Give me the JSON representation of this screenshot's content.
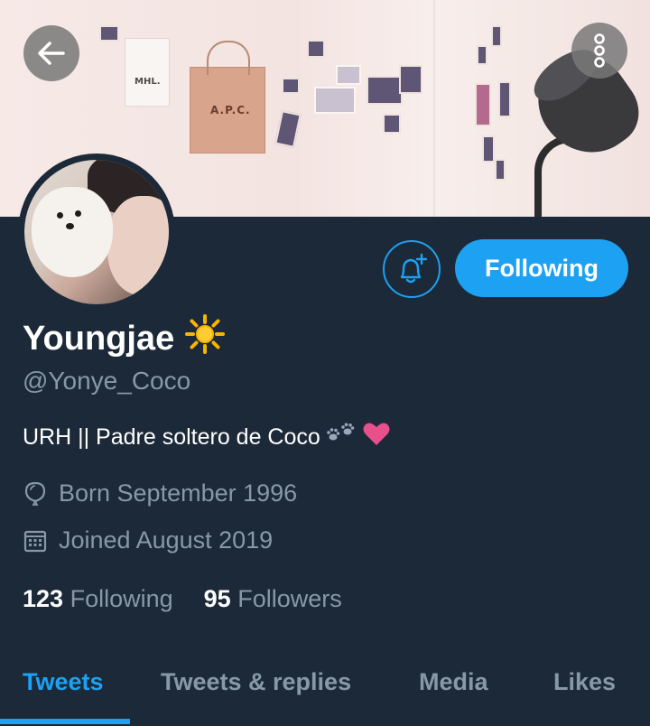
{
  "header": {
    "back_icon": "arrow-left-icon",
    "more_icon": "more-vertical-icon",
    "banner_bag_white_text": "MHL.",
    "banner_bag_kraft_text": "A.P.C."
  },
  "profile": {
    "name": "Youngjae",
    "name_emoji": "☀️",
    "handle": "@Yonye_Coco",
    "bio_text": "URH || Padre soltero de Coco",
    "bio_emojis": "🐾❤",
    "born": "Born September 1996",
    "joined": "Joined August 2019",
    "following_count": "123",
    "following_label": "Following",
    "followers_count": "95",
    "followers_label": "Followers"
  },
  "actions": {
    "notify_icon": "bell-plus-icon",
    "follow_button_label": "Following"
  },
  "tabs": [
    {
      "label": "Tweets",
      "active": true
    },
    {
      "label": "Tweets & replies",
      "active": false
    },
    {
      "label": "Media",
      "active": false
    },
    {
      "label": "Likes",
      "active": false
    }
  ],
  "colors": {
    "background": "#1c2938",
    "accent": "#1da1f2",
    "secondary_text": "#8899a6"
  }
}
